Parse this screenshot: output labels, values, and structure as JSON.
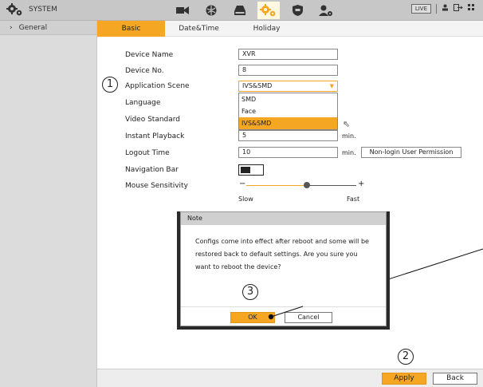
{
  "header": {
    "system_label": "SYSTEM",
    "live_badge": "LIVE",
    "nav_icons": [
      "camera-icon",
      "network-icon",
      "storage-icon",
      "system-gear-icon",
      "security-shield-icon",
      "account-icon"
    ]
  },
  "sidebar": {
    "items": [
      {
        "label": "General",
        "chevron": "›"
      }
    ]
  },
  "tabs": [
    {
      "label": "Basic",
      "active": true
    },
    {
      "label": "Date&Time",
      "active": false
    },
    {
      "label": "Holiday",
      "active": false
    }
  ],
  "form": {
    "device_name": {
      "label": "Device Name",
      "value": "XVR"
    },
    "device_no": {
      "label": "Device No.",
      "value": "8"
    },
    "application_scene": {
      "label": "Application Scene",
      "value": "IVS&SMD",
      "options": [
        "SMD",
        "Face",
        "IVS&SMD"
      ],
      "selected_index": 2
    },
    "language": {
      "label": "Language"
    },
    "video_standard": {
      "label": "Video Standard"
    },
    "instant_playback": {
      "label": "Instant Playback",
      "value": "5",
      "unit": "min."
    },
    "logout_time": {
      "label": "Logout Time",
      "value": "10",
      "unit": "min.",
      "permission_button": "Non-login User Permission"
    },
    "navigation_bar": {
      "label": "Navigation Bar",
      "enabled": true
    },
    "mouse_sensitivity": {
      "label": "Mouse Sensitivity",
      "minus": "−",
      "plus": "+",
      "slow_label": "Slow",
      "fast_label": "Fast",
      "level_fraction": 0.55
    }
  },
  "dialog": {
    "title": "Note",
    "message": "Configs come into effect after reboot and some will be restored back to default settings. Are you sure you want to reboot the device?",
    "ok_label": "OK",
    "cancel_label": "Cancel"
  },
  "footer": {
    "apply_label": "Apply",
    "back_label": "Back"
  },
  "steps": {
    "one": "1",
    "two": "2",
    "three": "3"
  },
  "colors": {
    "accent": "#f5a623",
    "topbar": "#c7c7c7",
    "sidebar": "#dcdcdc"
  }
}
